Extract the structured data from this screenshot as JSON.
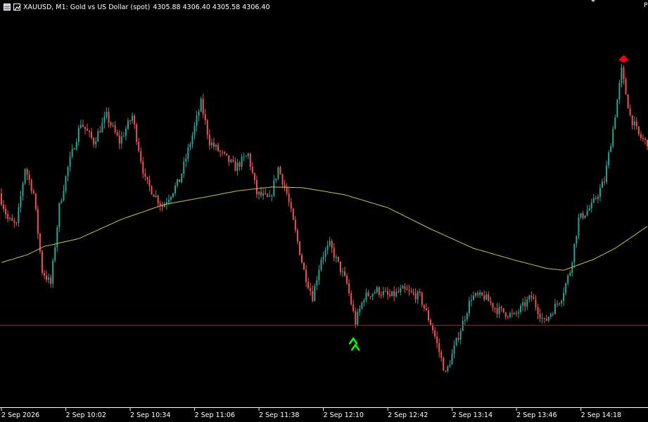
{
  "header": {
    "symbol_info": "XAUUSD, M1:  Gold vs US Dollar (spot)",
    "ohlc": "4305.88 4306.40 4305.58 4306.40",
    "corner_text": "P"
  },
  "colors": {
    "background": "#000000",
    "bull": "#26a69a",
    "bear": "#ef5350",
    "ma": "#c8c832",
    "hline": "#a01e1e",
    "arrow_up": "#00ff00",
    "arrow_down": "#ff0000",
    "axis_text": "#ffffff"
  },
  "chart_data": {
    "type": "candlestick",
    "symbol": "XAUUSD",
    "timeframe": "M1",
    "x_tick_labels": [
      "2 Sep 2026",
      "2 Sep 10:02",
      "2 Sep 10:34",
      "2 Sep 11:06",
      "2 Sep 11:38",
      "2 Sep 12:10",
      "2 Sep 12:42",
      "2 Sep 13:14",
      "2 Sep 13:46",
      "2 Sep 14:18"
    ],
    "x_tick_offsets_min": [
      0,
      32,
      64,
      96,
      128,
      160,
      192,
      224,
      256,
      288
    ],
    "visible_bars": 302,
    "y_range": [
      4285.0,
      4346.0
    ],
    "horizontal_line": 4297.6,
    "price_keypoints": [
      [
        0,
        4318.0
      ],
      [
        4,
        4314.0
      ],
      [
        8,
        4313.0
      ],
      [
        12,
        4322.0
      ],
      [
        16,
        4318.0
      ],
      [
        20,
        4306.0
      ],
      [
        24,
        4304.0
      ],
      [
        28,
        4316.0
      ],
      [
        32,
        4322.0
      ],
      [
        38,
        4329.0
      ],
      [
        44,
        4326.0
      ],
      [
        50,
        4330.0
      ],
      [
        56,
        4326.0
      ],
      [
        62,
        4330.0
      ],
      [
        68,
        4320.0
      ],
      [
        76,
        4316.0
      ],
      [
        84,
        4320.0
      ],
      [
        90,
        4327.0
      ],
      [
        94,
        4332.0
      ],
      [
        98,
        4326.0
      ],
      [
        104,
        4324.0
      ],
      [
        110,
        4322.0
      ],
      [
        116,
        4324.0
      ],
      [
        120,
        4318.0
      ],
      [
        126,
        4317.0
      ],
      [
        130,
        4322.0
      ],
      [
        134,
        4318.0
      ],
      [
        138,
        4312.0
      ],
      [
        142,
        4306.0
      ],
      [
        146,
        4302.0
      ],
      [
        150,
        4308.0
      ],
      [
        154,
        4310.0
      ],
      [
        158,
        4307.0
      ],
      [
        162,
        4304.0
      ],
      [
        166,
        4298.0
      ],
      [
        170,
        4302.0
      ],
      [
        176,
        4303.0
      ],
      [
        182,
        4302.0
      ],
      [
        188,
        4303.0
      ],
      [
        196,
        4302.0
      ],
      [
        202,
        4297.0
      ],
      [
        208,
        4290.0
      ],
      [
        214,
        4296.0
      ],
      [
        220,
        4302.0
      ],
      [
        226,
        4302.0
      ],
      [
        232,
        4300.0
      ],
      [
        240,
        4299.0
      ],
      [
        248,
        4302.0
      ],
      [
        254,
        4298.0
      ],
      [
        258,
        4300.0
      ],
      [
        262,
        4302.0
      ],
      [
        266,
        4306.0
      ],
      [
        270,
        4314.0
      ],
      [
        276,
        4316.0
      ],
      [
        282,
        4320.0
      ],
      [
        286,
        4328.0
      ],
      [
        290,
        4337.0
      ],
      [
        294,
        4330.0
      ],
      [
        298,
        4327.0
      ],
      [
        301,
        4326.0
      ]
    ],
    "moving_average": [
      [
        0,
        4307.3
      ],
      [
        12,
        4308.5
      ],
      [
        20,
        4309.8
      ],
      [
        36,
        4311.0
      ],
      [
        56,
        4314.0
      ],
      [
        76,
        4316.3
      ],
      [
        96,
        4317.5
      ],
      [
        110,
        4318.4
      ],
      [
        126,
        4319.0
      ],
      [
        140,
        4318.9
      ],
      [
        160,
        4317.8
      ],
      [
        180,
        4315.8
      ],
      [
        200,
        4312.5
      ],
      [
        220,
        4309.5
      ],
      [
        240,
        4307.6
      ],
      [
        254,
        4306.4
      ],
      [
        262,
        4306.1
      ],
      [
        276,
        4307.8
      ],
      [
        286,
        4309.5
      ],
      [
        301,
        4312.9
      ]
    ],
    "signals": [
      {
        "type": "buy",
        "bar": 164,
        "price": 4295.2
      },
      {
        "type": "sell",
        "bar": 290,
        "price": 4338.8
      }
    ]
  }
}
